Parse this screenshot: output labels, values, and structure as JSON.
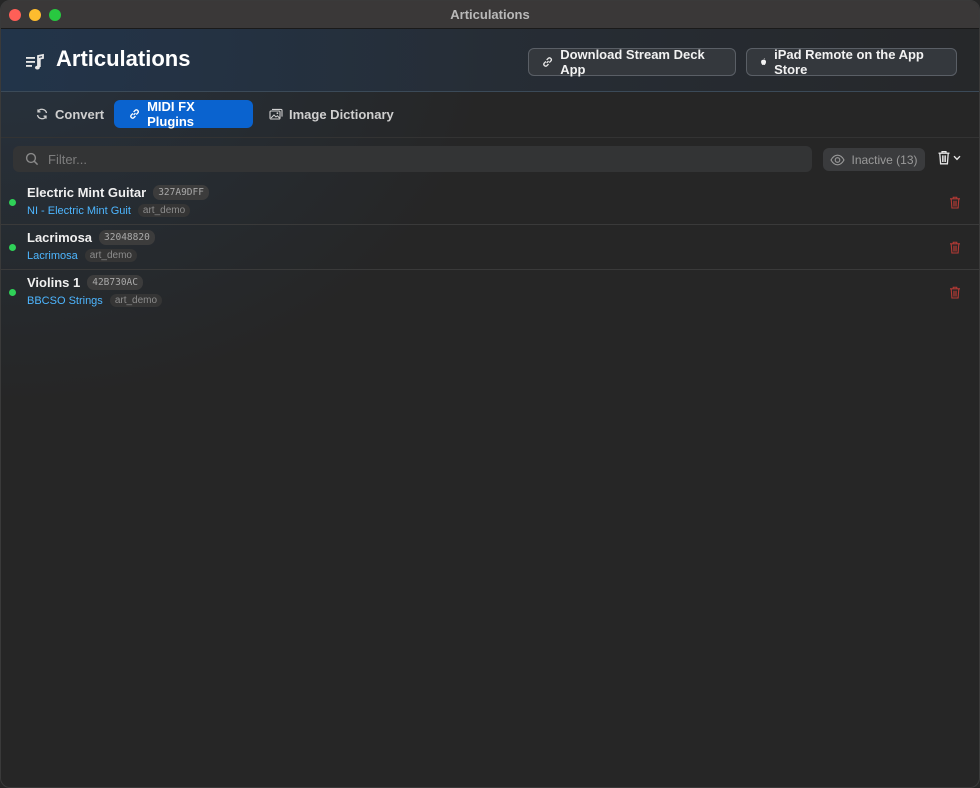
{
  "window": {
    "title": "Articulations"
  },
  "header": {
    "title": "Articulations",
    "stream_deck_label": "Download Stream Deck App",
    "ipad_label": "iPad Remote on the App Store"
  },
  "tabs": [
    {
      "label": "Convert",
      "active": false
    },
    {
      "label": "MIDI FX Plugins",
      "active": true
    },
    {
      "label": "Image Dictionary",
      "active": false
    }
  ],
  "filter": {
    "placeholder": "Filter...",
    "value": "",
    "inactive_label": "Inactive (13)"
  },
  "plugins": [
    {
      "name": "Electric Mint Guitar",
      "id": "327A9DFF",
      "instrument": "NI - Electric Mint Guit",
      "tag": "art_demo",
      "status": "active"
    },
    {
      "name": "Lacrimosa",
      "id": "32048820",
      "instrument": "Lacrimosa",
      "tag": "art_demo",
      "status": "active"
    },
    {
      "name": "Violins 1",
      "id": "42B730AC",
      "instrument": "BBCSO Strings",
      "tag": "art_demo",
      "status": "active"
    }
  ],
  "colors": {
    "accent": "#0a63cf",
    "active_dot": "#2fd158",
    "instrument_text": "#4db6ff",
    "delete": "#b53a35"
  }
}
